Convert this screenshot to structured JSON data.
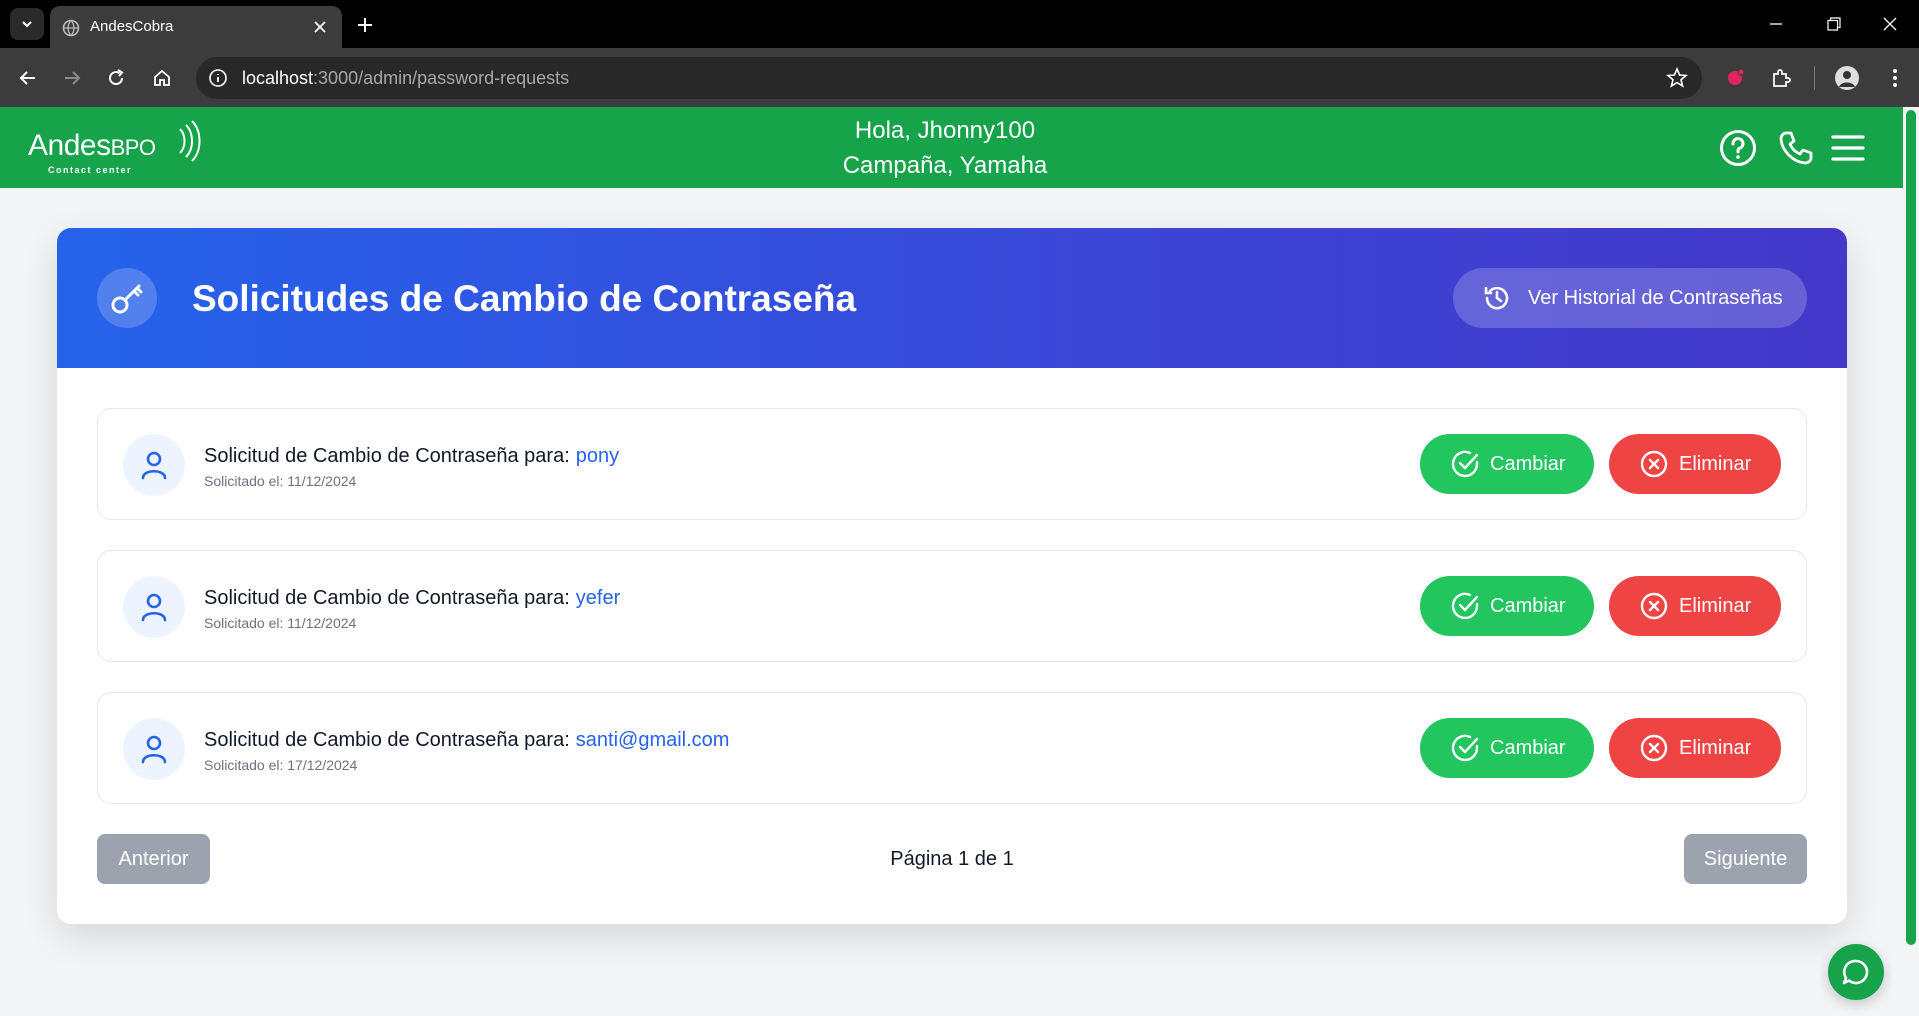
{
  "browser": {
    "tab_title": "AndesCobra",
    "url_host": "localhost",
    "url_rest": ":3000/admin/password-requests"
  },
  "header": {
    "logo_main": "Andes",
    "logo_bpo": "BPO",
    "logo_sub": "Contact center",
    "greeting": "Hola, Jhonny100",
    "campaign": "Campaña, Yamaha"
  },
  "card": {
    "title": "Solicitudes de Cambio de Contraseña",
    "history_button": "Ver Historial de Contraseñas"
  },
  "requests": [
    {
      "label": "Solicitud de Cambio de Contraseña para:",
      "user": "pony",
      "date": "Solicitado el: 11/12/2024",
      "change": "Cambiar",
      "delete": "Eliminar"
    },
    {
      "label": "Solicitud de Cambio de Contraseña para:",
      "user": "yefer",
      "date": "Solicitado el: 11/12/2024",
      "change": "Cambiar",
      "delete": "Eliminar"
    },
    {
      "label": "Solicitud de Cambio de Contraseña para:",
      "user": "santi@gmail.com",
      "date": "Solicitado el: 17/12/2024",
      "change": "Cambiar",
      "delete": "Eliminar"
    }
  ],
  "pagination": {
    "prev": "Anterior",
    "info": "Página 1 de 1",
    "next": "Siguiente"
  },
  "colors": {
    "brand_green": "#16a34a",
    "header_gradient_start": "#2563eb",
    "header_gradient_end": "#4338ca",
    "change_green": "#22c55e",
    "delete_red": "#ef4444",
    "user_link_blue": "#2563eb",
    "disabled_gray": "#9ca3af"
  },
  "icons": {
    "key": "key-icon",
    "history": "history-icon",
    "user": "user-icon",
    "check": "check-circle-icon",
    "x": "x-circle-icon",
    "help": "help-circle-icon",
    "phone": "phone-icon",
    "menu": "menu-icon",
    "chat": "chat-icon"
  }
}
